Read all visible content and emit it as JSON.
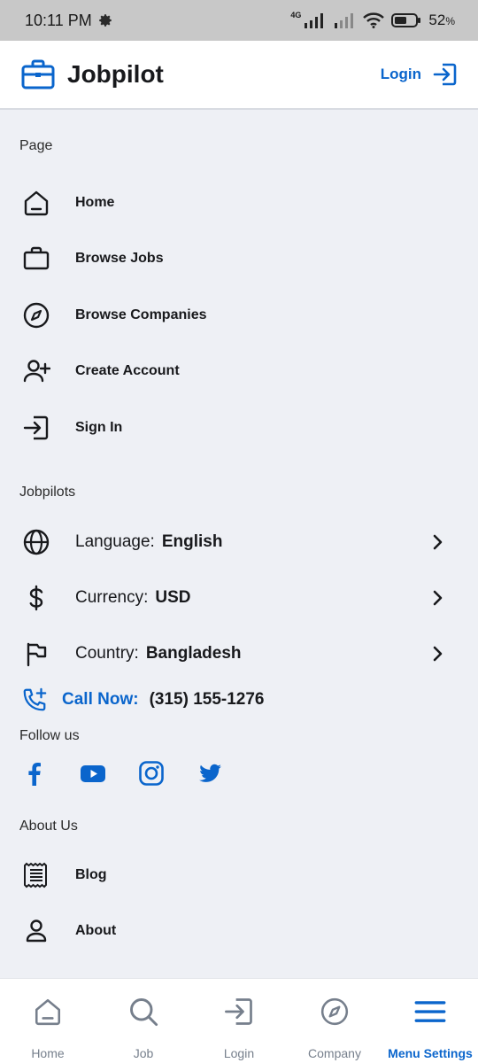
{
  "status_bar": {
    "time": "10:11 PM",
    "network": "4G",
    "battery": "52"
  },
  "header": {
    "brand": "Jobpilot",
    "login_label": "Login"
  },
  "page_section": {
    "title": "Page",
    "items": [
      {
        "label": "Home",
        "icon": "home-icon"
      },
      {
        "label": "Browse Jobs",
        "icon": "briefcase-icon"
      },
      {
        "label": "Browse Companies",
        "icon": "compass-icon"
      },
      {
        "label": "Create Account",
        "icon": "user-plus-icon"
      },
      {
        "label": "Sign In",
        "icon": "sign-in-icon"
      }
    ]
  },
  "jobpilots_section": {
    "title": "Jobpilots",
    "language": {
      "key": "Language:",
      "value": "English"
    },
    "currency": {
      "key": "Currency:",
      "value": "USD"
    },
    "country": {
      "key": "Country:",
      "value": "Bangladesh"
    },
    "call": {
      "label": "Call Now:",
      "number": "(315) 155-1276"
    }
  },
  "follow_section": {
    "title": "Follow us",
    "socials": [
      "facebook-icon",
      "youtube-icon",
      "instagram-icon",
      "twitter-icon"
    ]
  },
  "about_section": {
    "title": "About Us",
    "items": [
      {
        "label": "Blog",
        "icon": "blog-icon"
      },
      {
        "label": "About",
        "icon": "user-icon"
      }
    ]
  },
  "bottom_nav": {
    "items": [
      {
        "label": "Home",
        "icon": "home-icon"
      },
      {
        "label": "Job",
        "icon": "search-icon"
      },
      {
        "label": "Login",
        "icon": "login-icon"
      },
      {
        "label": "Company",
        "icon": "compass-icon"
      },
      {
        "label": "Menu Settings",
        "icon": "menu-icon",
        "active": true
      }
    ]
  },
  "colors": {
    "accent": "#0a65cc",
    "text": "#18191c",
    "muted": "#767f8c",
    "background": "#eef0f5"
  }
}
